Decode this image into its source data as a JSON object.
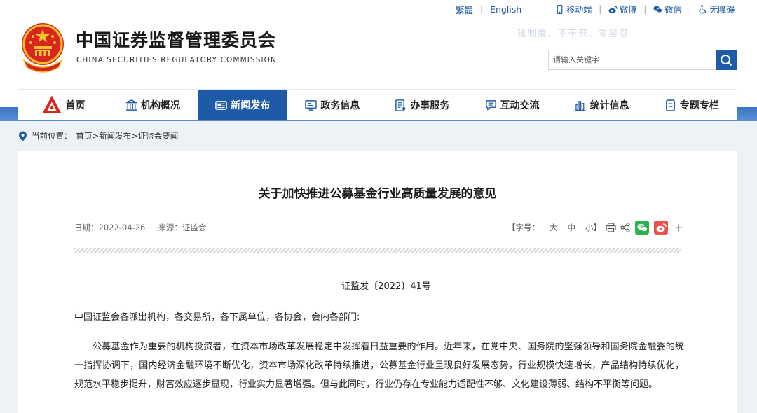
{
  "header": {
    "title_cn": "中国证券监督管理委员会",
    "title_en": "CHINA SECURITIES REGULATORY COMMISSION",
    "watermark": "建制度、不干预、零容忍",
    "top_links": {
      "traditional": "繁體",
      "english": "English",
      "mobile": "移动端",
      "weibo": "微博",
      "wechat": "微信",
      "accessibility": "无障碍"
    },
    "search": {
      "placeholder": "请输入关键字"
    }
  },
  "nav": {
    "items": [
      {
        "label": "首页",
        "icon": "csrc-logo-icon"
      },
      {
        "label": "机构概况",
        "icon": "institution-icon"
      },
      {
        "label": "新闻发布",
        "icon": "news-icon",
        "active": true
      },
      {
        "label": "政务信息",
        "icon": "monitor-icon"
      },
      {
        "label": "办事服务",
        "icon": "service-icon"
      },
      {
        "label": "互动交流",
        "icon": "chat-icon"
      },
      {
        "label": "统计信息",
        "icon": "stats-icon"
      },
      {
        "label": "专题专栏",
        "icon": "column-icon"
      }
    ],
    "active_color": "#1d5aa7"
  },
  "breadcrumb": {
    "prefix": "当前位置：",
    "path": "首页>新闻发布>证监会要闻"
  },
  "article": {
    "title": "关于加快推进公募基金行业高质量发展的意见",
    "date": "日期：2022-04-26",
    "source": "来源：证监会",
    "font_size_label": "【字号：",
    "font_large": "大",
    "font_medium": "中",
    "font_small": "小】",
    "doc_number": "证监发〔2022〕41号",
    "addressee": "中国证监会各派出机构，各交易所，各下属单位，各协会，会内各部门:",
    "paragraph": "公募基金作为重要的机构投资者，在资本市场改革发展稳定中发挥着日益重要的作用。近年来，在党中央、国务院的坚强领导和国务院金融委的统一指挥协调下，国内经济金融环境不断优化，资本市场深化改革持续推进，公募基金行业呈现良好发展态势，行业规模快速增长，产品结构持续优化，规范水平稳步提升，财富效应逐步显现，行业实力显著增强。但与此同时，行业仍存在专业能力适配性不够、文化建设薄弱、结构不平衡等问题。"
  },
  "colors": {
    "brand_blue": "#1d5aa7",
    "wechat_green": "#2bb24c",
    "weibo_red": "#e8534e"
  }
}
